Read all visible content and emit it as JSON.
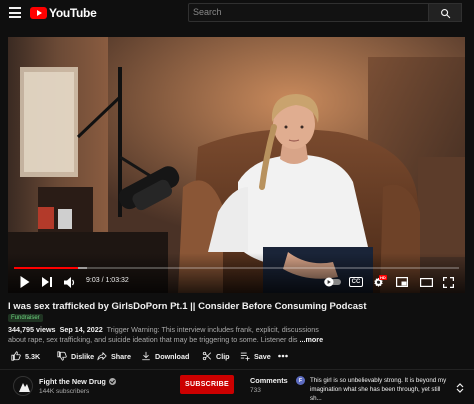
{
  "header": {
    "logo_text": "YouTube",
    "search_placeholder": "Search",
    "icons": [
      "menu-icon",
      "youtube-logo",
      "search-icon"
    ]
  },
  "player": {
    "current_time": "9:03",
    "duration": "1:03:32",
    "time_display": "9:03 / 1:03:32",
    "played_fraction": 0.143,
    "buffered_fraction": 0.165,
    "cc_label": "CC",
    "hd_label": "HD",
    "icons": [
      "play-icon",
      "next-icon",
      "volume-icon",
      "autoplay-toggle-icon",
      "captions-icon",
      "settings-icon",
      "miniplayer-icon",
      "theater-icon",
      "fullscreen-icon"
    ]
  },
  "video": {
    "title": "I was sex trafficked by GirlsDoPorn Pt.1 || Consider Before Consuming Podcast",
    "badge": "Fundraiser",
    "views": "344,795 views",
    "date": "Sep 14, 2022",
    "description_line1": "Trigger Warning: This interview includes frank, explicit, discussions",
    "description_line2": "about rape, sex trafficking, and suicide ideation that may be triggering to some. Listener dis",
    "more_label": "...more"
  },
  "actions": {
    "like_count": "5.3K",
    "dislike_label": "Dislike",
    "share_label": "Share",
    "download_label": "Download",
    "clip_label": "Clip",
    "save_label": "Save",
    "more_icon": "more-horizontal-icon"
  },
  "channel": {
    "name": "Fight the New Drug",
    "subscribers": "144K subscribers",
    "subscribe_label": "SUBSCRIBE"
  },
  "comments": {
    "label": "Comments",
    "count": "733",
    "top_comment_avatar": "F",
    "top_comment": "This girl is so unbelievably strong. It is beyond my imagination what she has been through, yet still sh..."
  },
  "colors": {
    "background": "#0f0f0f",
    "brand_red": "#ff0000",
    "subscribe_red": "#cc0000",
    "text_primary": "#f1f1f1",
    "text_secondary": "#aaaaaa"
  }
}
